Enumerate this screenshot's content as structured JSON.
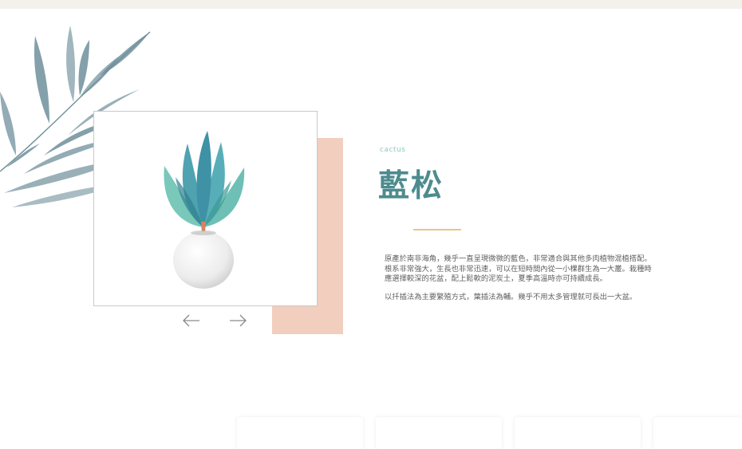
{
  "colors": {
    "teal": "#4d8b8e",
    "light_teal": "#8fc7c0",
    "peach": "#f2cebe",
    "gold": "#ebc485",
    "leaf": "#6f8f9b",
    "topbar": "#f4f0ec"
  },
  "decor": {
    "leaves_icon": "watercolor-leaf-branch",
    "plant_image": "succulent-in-white-pot"
  },
  "slider": {
    "prev_icon": "arrow-left",
    "next_icon": "arrow-right"
  },
  "product": {
    "category": "cactus",
    "name": "藍松",
    "description": "原產於南非海角，幾乎一直呈現微微的藍色，非常適合與其他多肉植物混植搭配。\n根系非常強大，生長也非常迅速，可以在短時間內從一小棵群生為一大叢。栽種時\n應選擇較深的花盆，配上鬆軟的泥炭土，夏季高溫時亦可持續成長。",
    "propagation": "以扦插法為主要繁殖方式，葉插法為輔。幾乎不用太多管理就可長出一大盆。"
  }
}
